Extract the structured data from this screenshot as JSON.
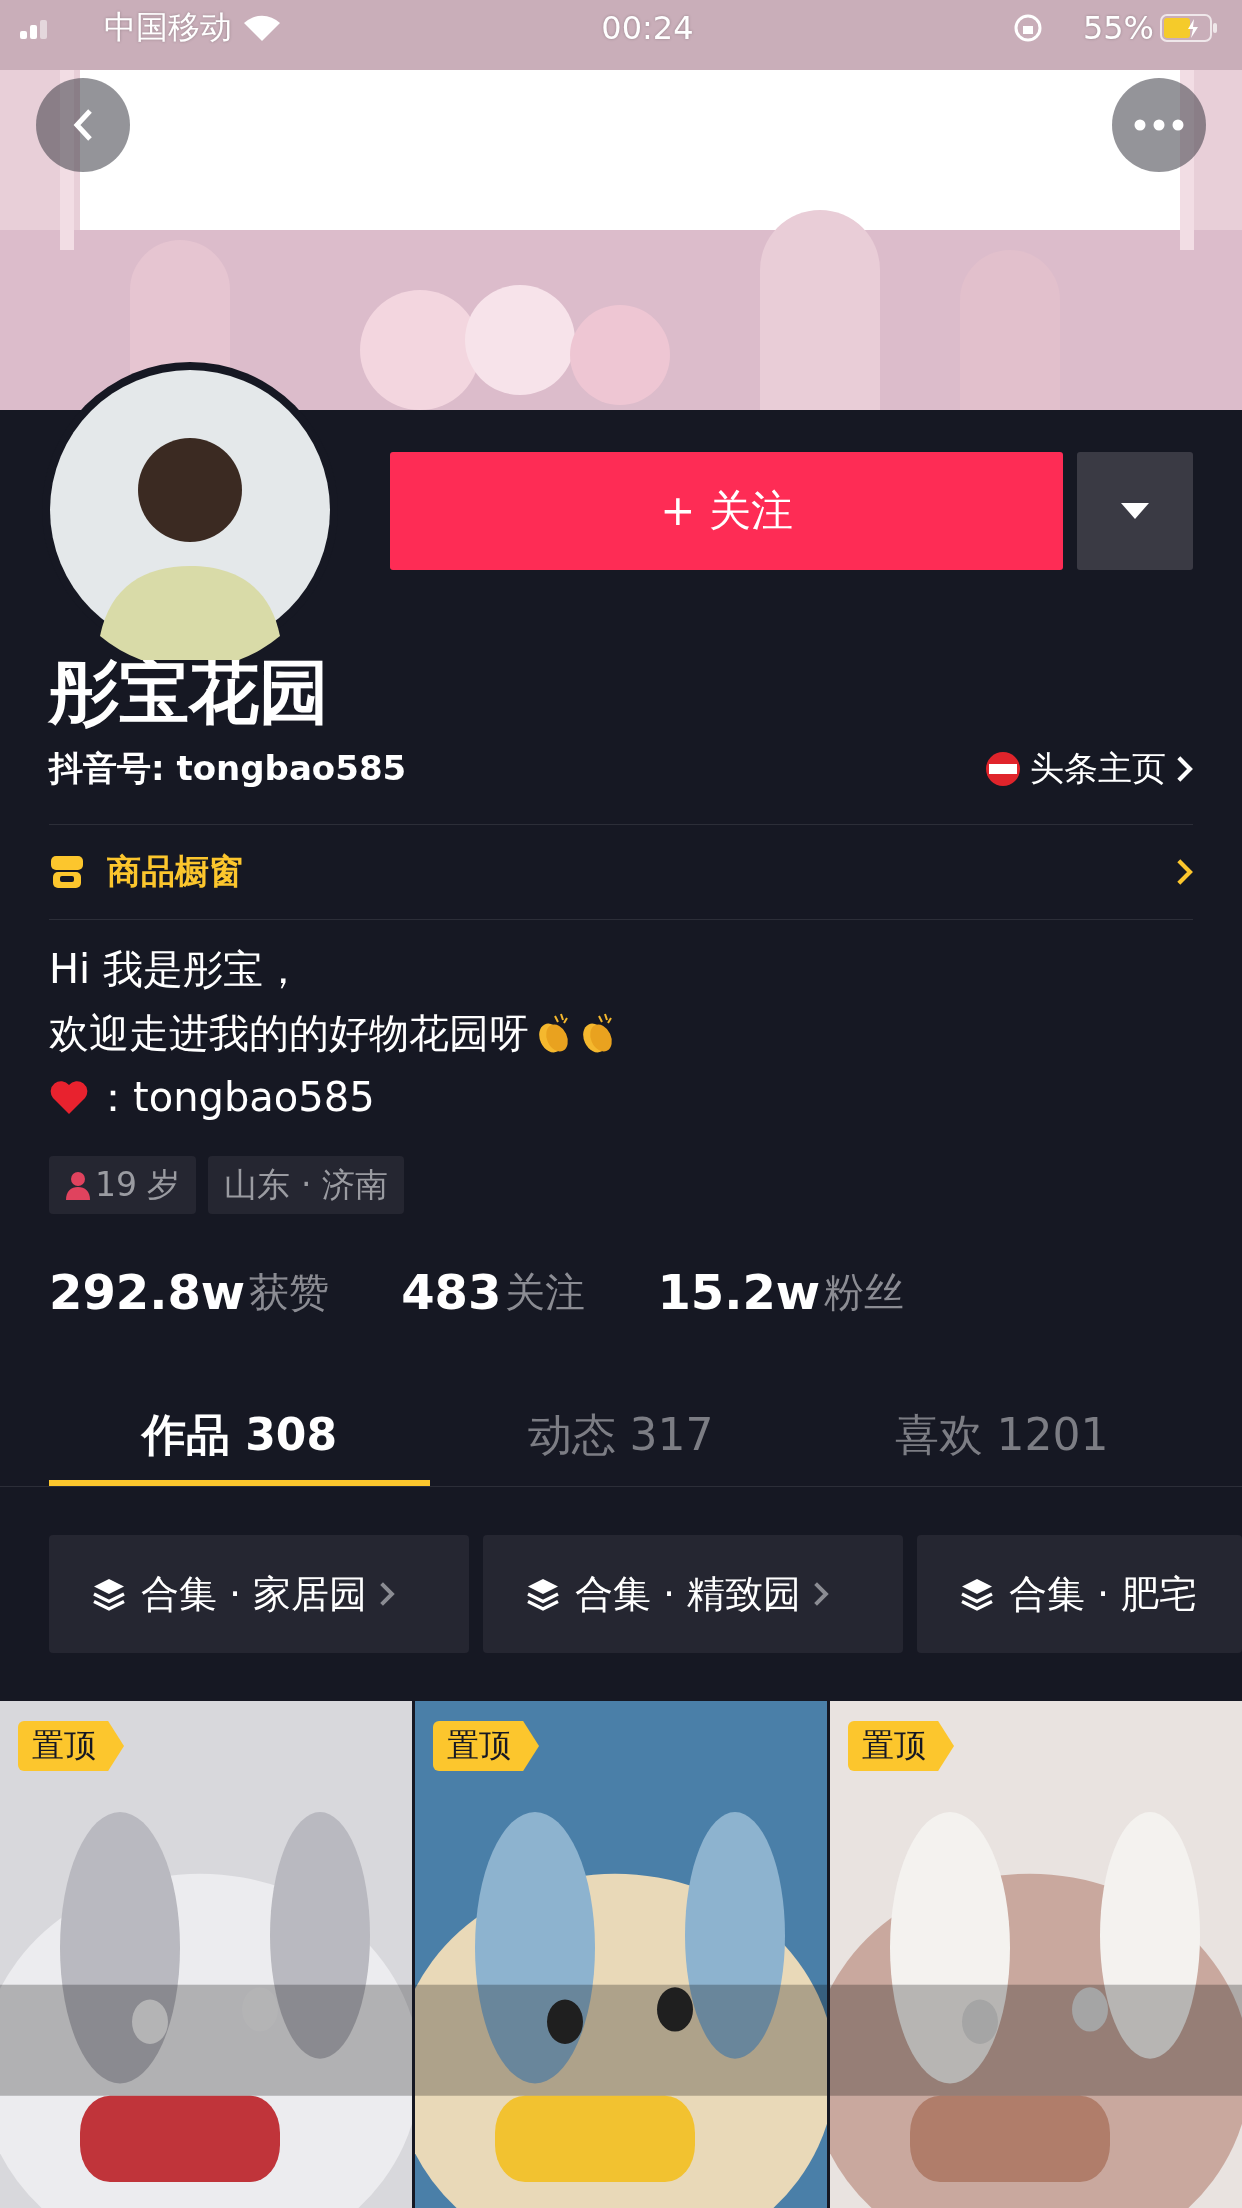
{
  "status_bar": {
    "carrier": "中国移动",
    "time": "00:24",
    "battery": "55%"
  },
  "follow_button": {
    "label": "+ 关注"
  },
  "profile": {
    "name": "彤宝花园",
    "account": "抖音号: tongbao585",
    "toutiao_link": "头条主页"
  },
  "shop_window": {
    "label": "商品橱窗"
  },
  "bio": [
    "Hi 我是彤宝，",
    "欢迎走进我的的好物花园呀",
    "：tongbao585"
  ],
  "tags": [
    {
      "kind": "age",
      "label": "19 岁"
    },
    {
      "kind": "place",
      "label": "山东 · 济南"
    }
  ],
  "stats": [
    {
      "count": "292.8w",
      "name": "获赞"
    },
    {
      "count": "483",
      "name": "关注"
    },
    {
      "count": "15.2w",
      "name": "粉丝"
    }
  ],
  "tabs": [
    {
      "label": "作品 308",
      "selected": true
    },
    {
      "label": "动态 317",
      "selected": false
    },
    {
      "label": "喜欢 1201",
      "selected": false
    }
  ],
  "collections": [
    {
      "label": "合集 · 家居园"
    },
    {
      "label": "合集 · 精致园"
    },
    {
      "label": "合集 · 肥宅"
    }
  ],
  "videos": [
    {
      "badge": "置顶"
    },
    {
      "badge": "置顶"
    },
    {
      "badge": "置顶"
    }
  ]
}
